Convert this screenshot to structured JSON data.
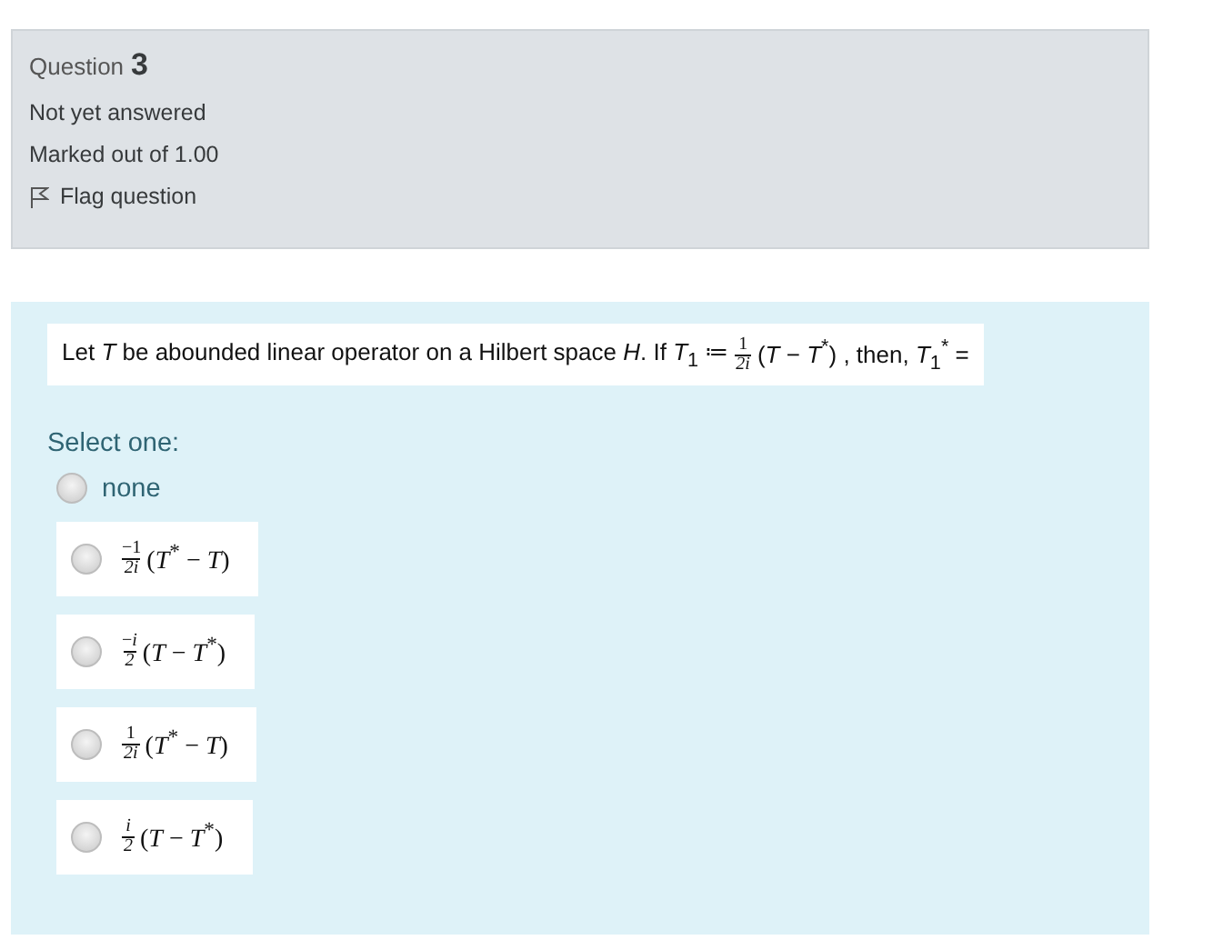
{
  "info": {
    "label": "Question",
    "number": "3",
    "status": "Not yet answered",
    "mark": "Marked out of 1.00",
    "flag": "Flag question"
  },
  "question": {
    "before": "Let *T*  be abounded linear operator on a Hilbert space *H*. If *T*$_{1}$ ≔",
    "fraction": {
      "numerator": "1",
      "denominator": "2i"
    },
    "after": "(*T* − *T*$^{*}$) , then,  *T*$_{1}$$^{*}$ ="
  },
  "select_label": "Select one:",
  "options": [
    {
      "kind": "text",
      "label": "none",
      "selected": false
    },
    {
      "kind": "formula",
      "numerator": "−1",
      "denominator": "2i",
      "expression": "(*T*$^{*}$ − *T*)",
      "selected": false
    },
    {
      "kind": "formula",
      "numerator": "−*i*",
      "denominator": "2",
      "expression": "(*T* − *T*$^{*}$)",
      "selected": false
    },
    {
      "kind": "formula",
      "numerator": "1",
      "denominator": "2i",
      "expression": "(*T*$^{*}$ − *T*)",
      "selected": false
    },
    {
      "kind": "formula",
      "numerator": "*i*",
      "denominator": "2",
      "expression": "(*T* − *T*$^{*}$)",
      "selected": false
    }
  ]
}
